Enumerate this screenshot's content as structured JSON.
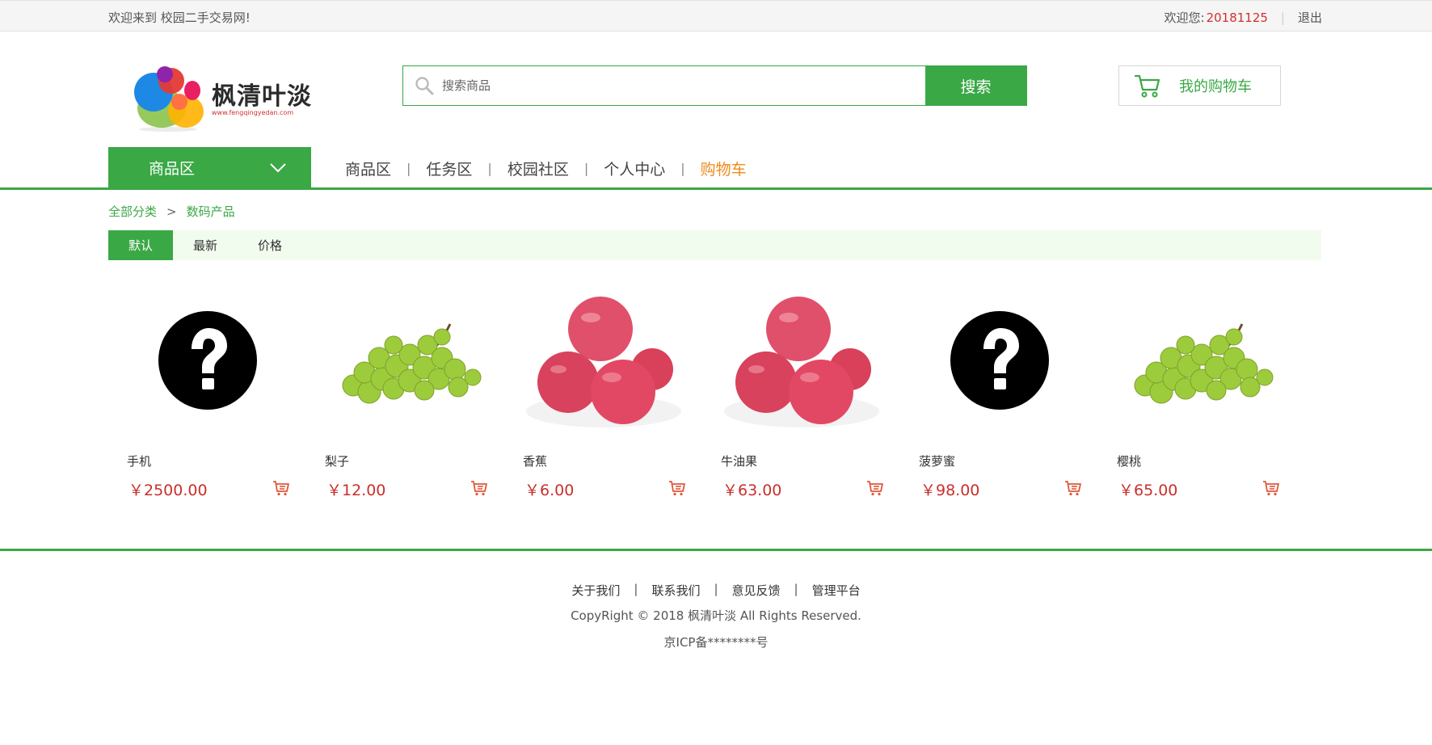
{
  "topbar": {
    "welcome": "欢迎来到 校园二手交易网!",
    "greeting": "欢迎您:",
    "user_id": "20181125",
    "logout": "退出"
  },
  "logo": {
    "brand": "枫清叶淡",
    "url": "www.fengqingyedan.com"
  },
  "search": {
    "placeholder": "搜索商品",
    "button": "搜索"
  },
  "cart": {
    "label": "我的购物车"
  },
  "category_button": "商品区",
  "nav": {
    "items": [
      "商品区",
      "任务区",
      "校园社区",
      "个人中心",
      "购物车"
    ],
    "separator": "|",
    "active_index": 4
  },
  "breadcrumb": {
    "root": "全部分类",
    "separator": ">",
    "current": "数码产品"
  },
  "sort": {
    "options": [
      "默认",
      "最新",
      "价格"
    ],
    "active_index": 0
  },
  "products": [
    {
      "name": "手机",
      "price": "￥2500.00",
      "image": "question-placeholder"
    },
    {
      "name": "梨子",
      "price": "￥12.00",
      "image": "grapes"
    },
    {
      "name": "香蕉",
      "price": "￥6.00",
      "image": "apples"
    },
    {
      "name": "牛油果",
      "price": "￥63.00",
      "image": "apples"
    },
    {
      "name": "菠萝蜜",
      "price": "￥98.00",
      "image": "question-placeholder"
    },
    {
      "name": "樱桃",
      "price": "￥65.00",
      "image": "grapes"
    }
  ],
  "footer": {
    "links": [
      "关于我们",
      "联系我们",
      "意见反馈",
      "管理平台"
    ],
    "separator": "|",
    "copyright": "CopyRight © 2018 枫清叶淡 All Rights Reserved.",
    "icp": "京ICP备********号"
  },
  "colors": {
    "accent": "#3aa845",
    "price": "#c9302c",
    "nav_active": "#f08a1c",
    "user_id": "#d32f2f"
  }
}
